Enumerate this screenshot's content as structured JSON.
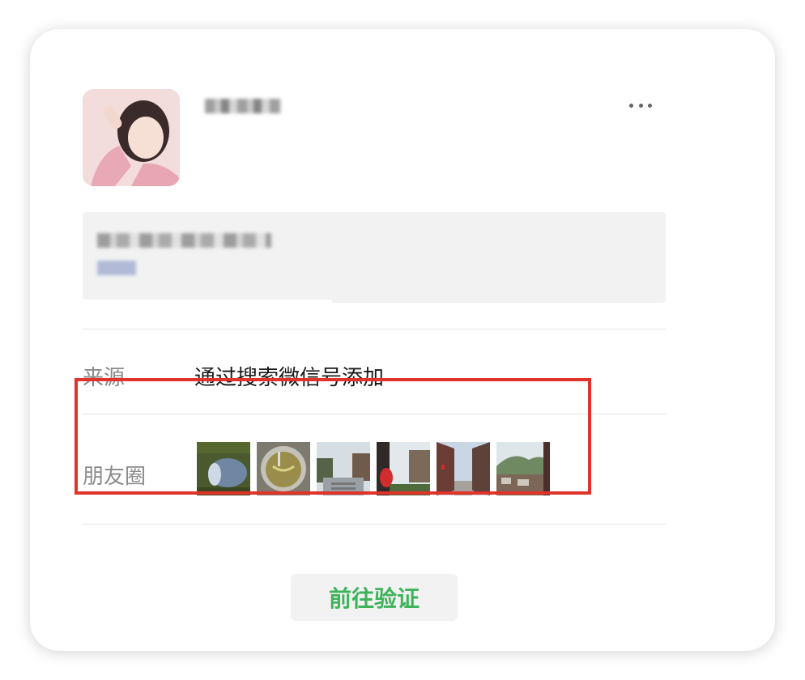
{
  "profile": {
    "avatar_icon": "avatar-photo",
    "nickname_blurred": true,
    "more_icon": "more-dots-icon"
  },
  "info": {
    "blurred": true
  },
  "source": {
    "label": "来源",
    "value": "通过搜索微信号添加"
  },
  "moments": {
    "label": "朋友圈",
    "thumbnails": [
      {
        "name": "moss-water-photo"
      },
      {
        "name": "bowl-broth-photo"
      },
      {
        "name": "stair-street-photo"
      },
      {
        "name": "red-lantern-photo"
      },
      {
        "name": "old-street-photo"
      },
      {
        "name": "mountain-town-photo"
      }
    ]
  },
  "actions": {
    "verify_label": "前往验证"
  },
  "colors": {
    "accent_green": "#3fb35a",
    "highlight_red": "#e0342b"
  }
}
